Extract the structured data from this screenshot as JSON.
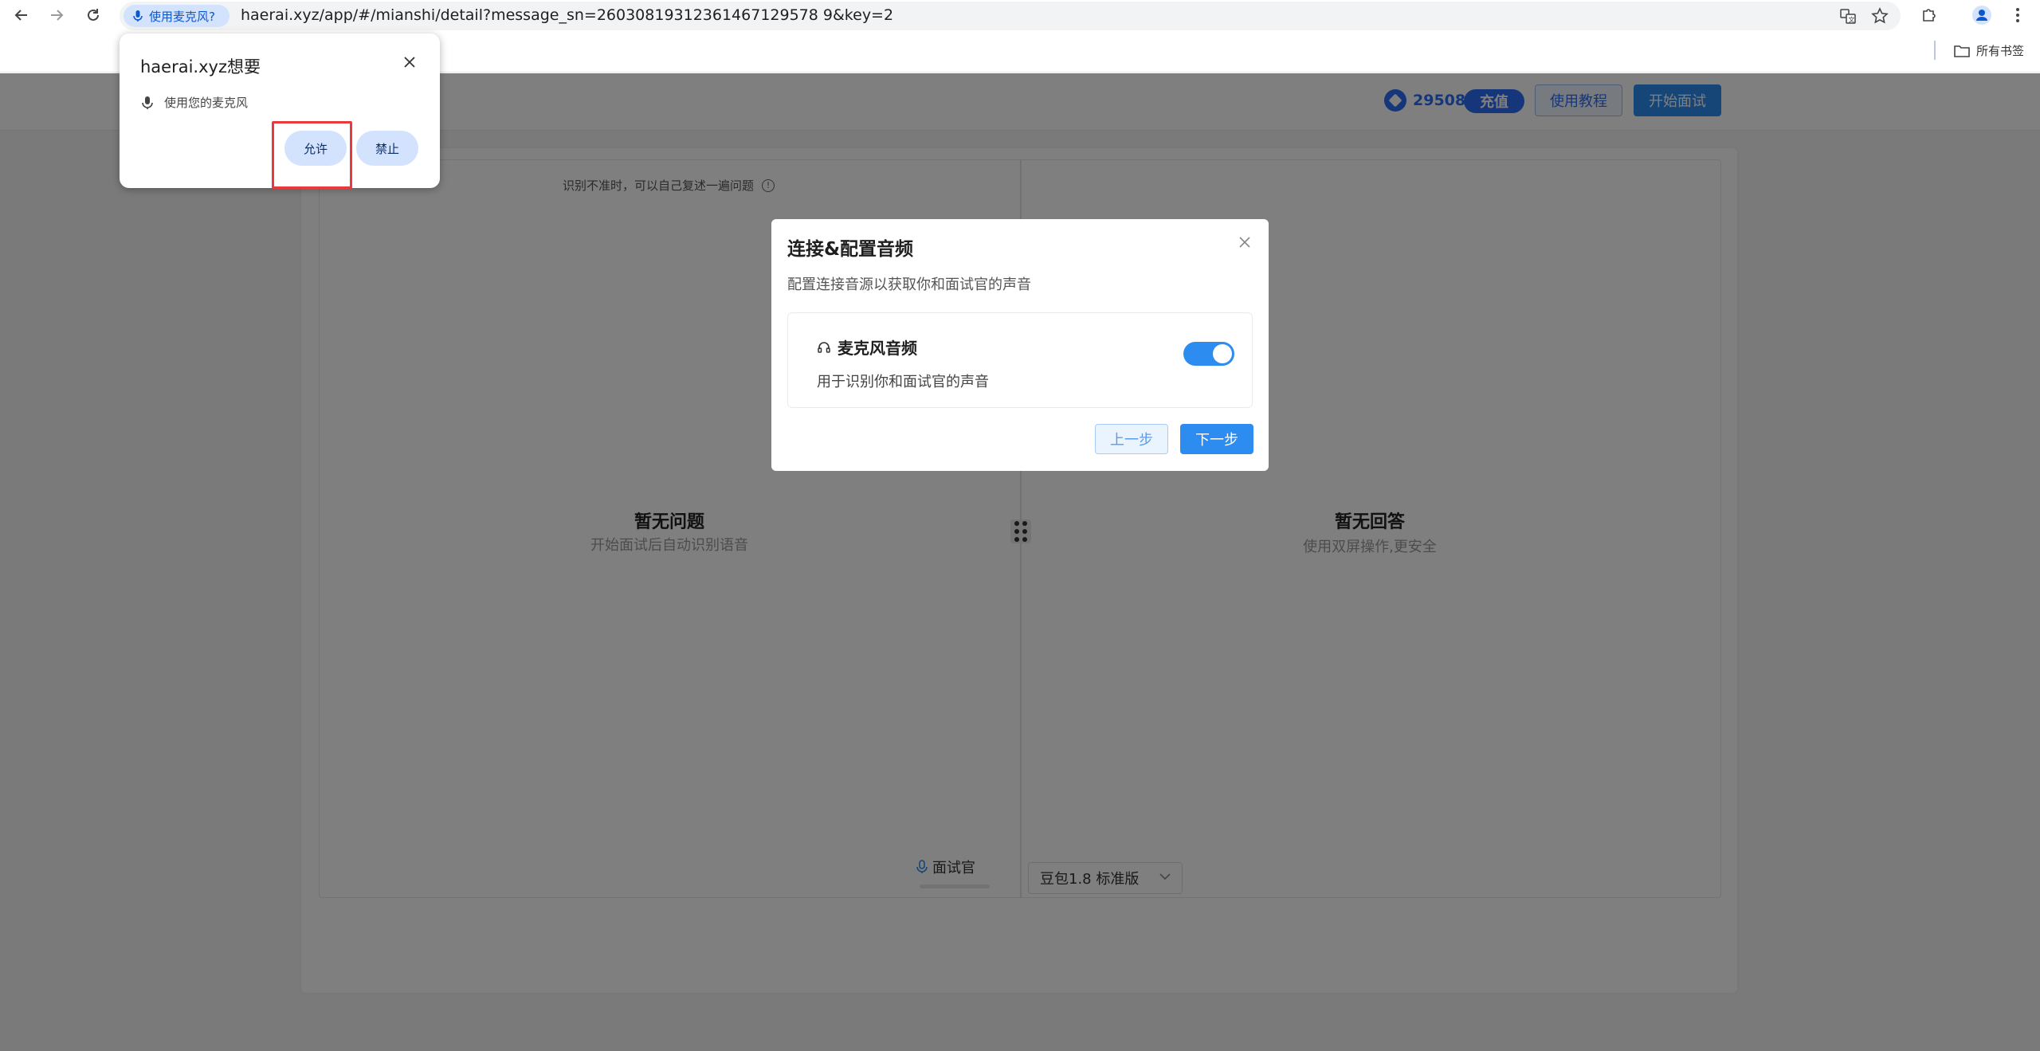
{
  "browser": {
    "mic_chip": "使用麦克风?",
    "url": "haerai.xyz/app/#/mianshi/detail?message_sn=26030819312361467129578 9&key=2",
    "bookmarks_label": "所有书签"
  },
  "header": {
    "points": "29508",
    "recharge_label": "充值",
    "tutorial_label": "使用教程",
    "start_label": "开始面试"
  },
  "left_panel": {
    "tip": "识别不准时，可以自己复述一遍问题",
    "empty_title": "暂无问题",
    "empty_sub": "开始面试后自动识别语音",
    "interviewer_label": "面试官"
  },
  "right_panel": {
    "empty_title": "暂无回答",
    "empty_sub": "使用双屏操作,更安全",
    "model_value": "豆包1.8 标准版"
  },
  "modal": {
    "title": "连接&配置音频",
    "desc": "配置连接音源以获取你和面试官的声音",
    "source_name": "麦克风音频",
    "source_desc": "用于识别你和面试官的声音",
    "toggle_on": true,
    "prev_label": "上一步",
    "next_label": "下一步"
  },
  "permission": {
    "title": "haerai.xyz想要",
    "request": "使用您的麦克风",
    "allow_label": "允许",
    "block_label": "禁止"
  },
  "colors": {
    "accent": "#2d8cf0",
    "highlight": "#e8393f"
  }
}
